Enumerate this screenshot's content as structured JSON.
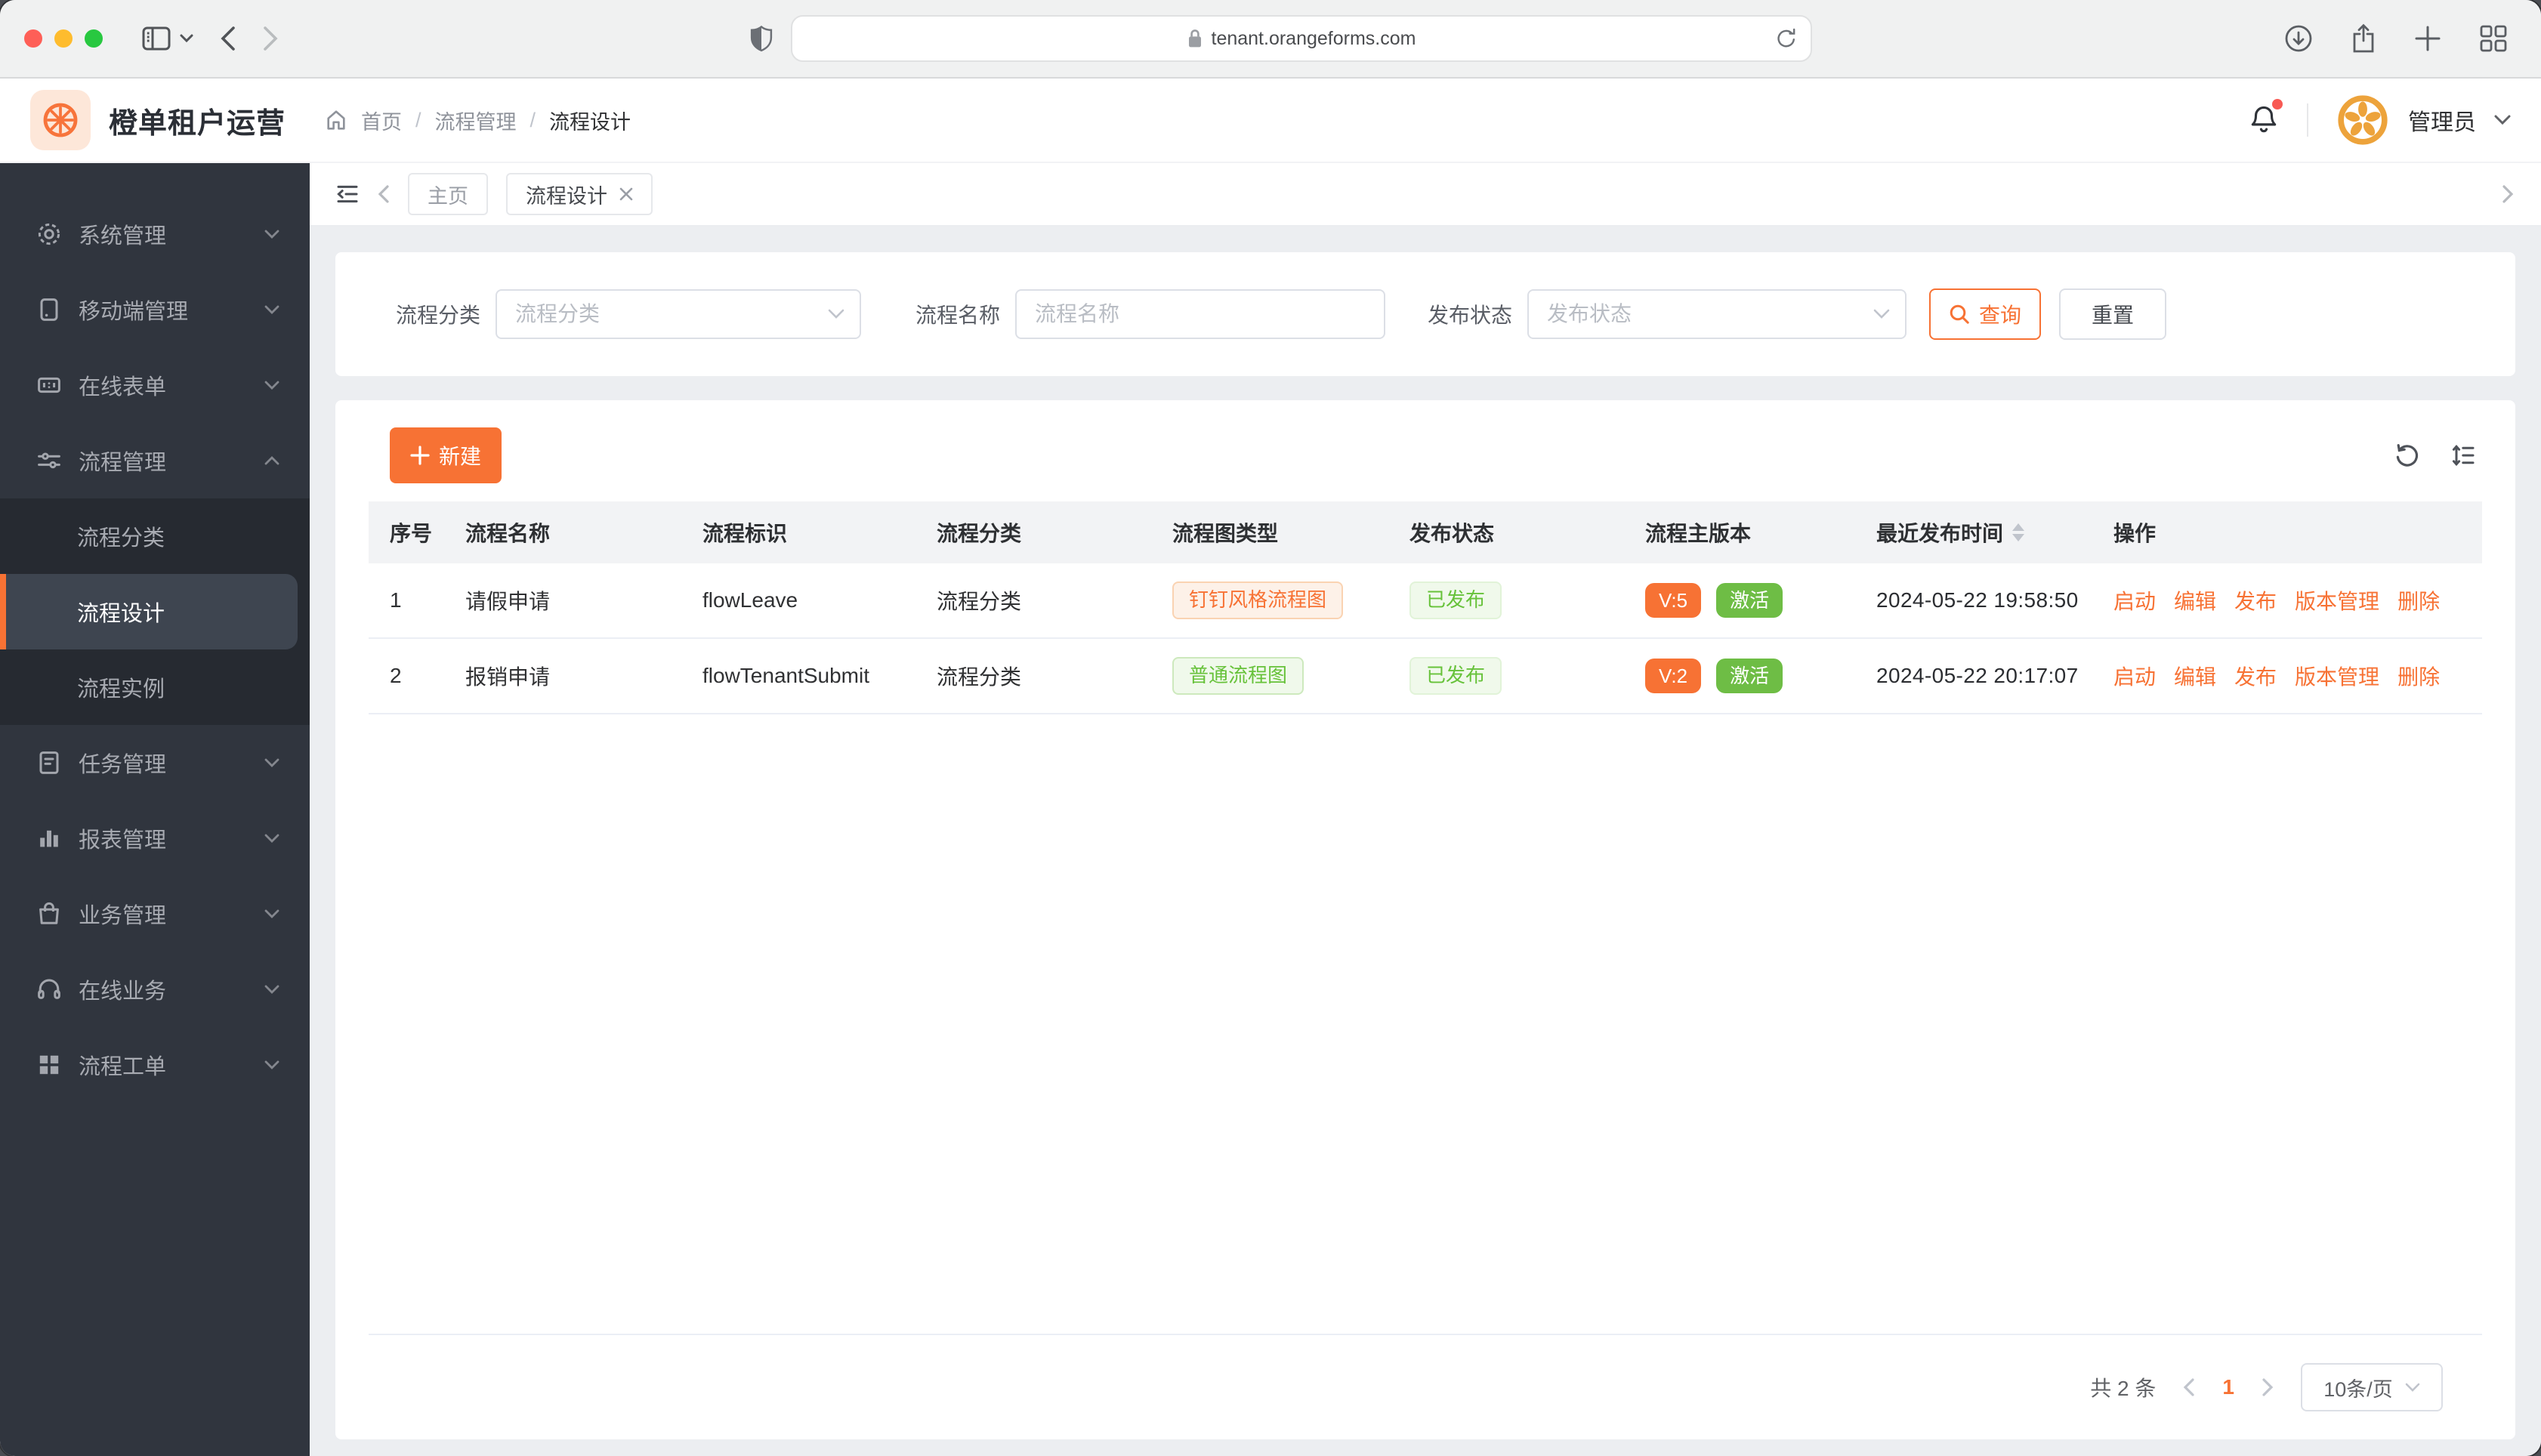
{
  "browser": {
    "url": "tenant.orangeforms.com"
  },
  "app_header": {
    "title": "橙单租户运营",
    "breadcrumb": [
      "首页",
      "流程管理",
      "流程设计"
    ],
    "separator": "/",
    "user": "管理员"
  },
  "sidebar": {
    "items": [
      {
        "label": "系统管理",
        "icon": "gear-icon"
      },
      {
        "label": "移动端管理",
        "icon": "mobile-icon"
      },
      {
        "label": "在线表单",
        "icon": "form-icon"
      },
      {
        "label": "流程管理",
        "icon": "sliders-icon",
        "expanded": true
      },
      {
        "label": "任务管理",
        "icon": "document-icon"
      },
      {
        "label": "报表管理",
        "icon": "bar-chart-icon"
      },
      {
        "label": "业务管理",
        "icon": "bag-icon"
      },
      {
        "label": "在线业务",
        "icon": "headset-icon"
      },
      {
        "label": "流程工单",
        "icon": "grid-icon"
      }
    ],
    "submenu": [
      {
        "label": "流程分类",
        "active": false
      },
      {
        "label": "流程设计",
        "active": true
      },
      {
        "label": "流程实例",
        "active": false
      }
    ]
  },
  "tabs": {
    "home": "主页",
    "active": "流程设计"
  },
  "filters": {
    "category_label": "流程分类",
    "category_placeholder": "流程分类",
    "name_label": "流程名称",
    "name_placeholder": "流程名称",
    "status_label": "发布状态",
    "status_placeholder": "发布状态",
    "query": "查询",
    "reset": "重置"
  },
  "toolbar": {
    "create": "新建"
  },
  "table": {
    "columns": [
      "序号",
      "流程名称",
      "流程标识",
      "流程分类",
      "流程图类型",
      "发布状态",
      "流程主版本",
      "最近发布时间",
      "操作"
    ],
    "rows": [
      {
        "index": "1",
        "name": "请假申请",
        "key": "flowLeave",
        "category": "流程分类",
        "diagram": "钉钉风格流程图",
        "diagram_type": "orange",
        "status": "已发布",
        "version": "V:5",
        "active": "激活",
        "published_at": "2024-05-22 19:58:50"
      },
      {
        "index": "2",
        "name": "报销申请",
        "key": "flowTenantSubmit",
        "category": "流程分类",
        "diagram": "普通流程图",
        "diagram_type": "green",
        "status": "已发布",
        "version": "V:2",
        "active": "激活",
        "published_at": "2024-05-22 20:17:07"
      }
    ],
    "actions": [
      "启动",
      "编辑",
      "发布",
      "版本管理",
      "删除"
    ]
  },
  "pagination": {
    "total": "共 2 条",
    "page": "1",
    "page_size": "10条/页"
  },
  "colors": {
    "primary": "#f77234",
    "success": "#67c23a",
    "active_badge": "#6ebd45",
    "tag_orange_bg": "#fdf1e8",
    "tag_orange_border": "#fad3b2",
    "tag_green_bg": "#f0f9eb",
    "tag_green_border": "#cde9bd",
    "sidebar_bg": "#30353e",
    "submenu_bg": "#262a31",
    "sidebar_active_bg": "#3e4550",
    "page_bg": "#eceef1",
    "notification_dot": "#f85a54",
    "logo_bg": "#fde7d9",
    "avatar_orange": "#eda33b"
  }
}
